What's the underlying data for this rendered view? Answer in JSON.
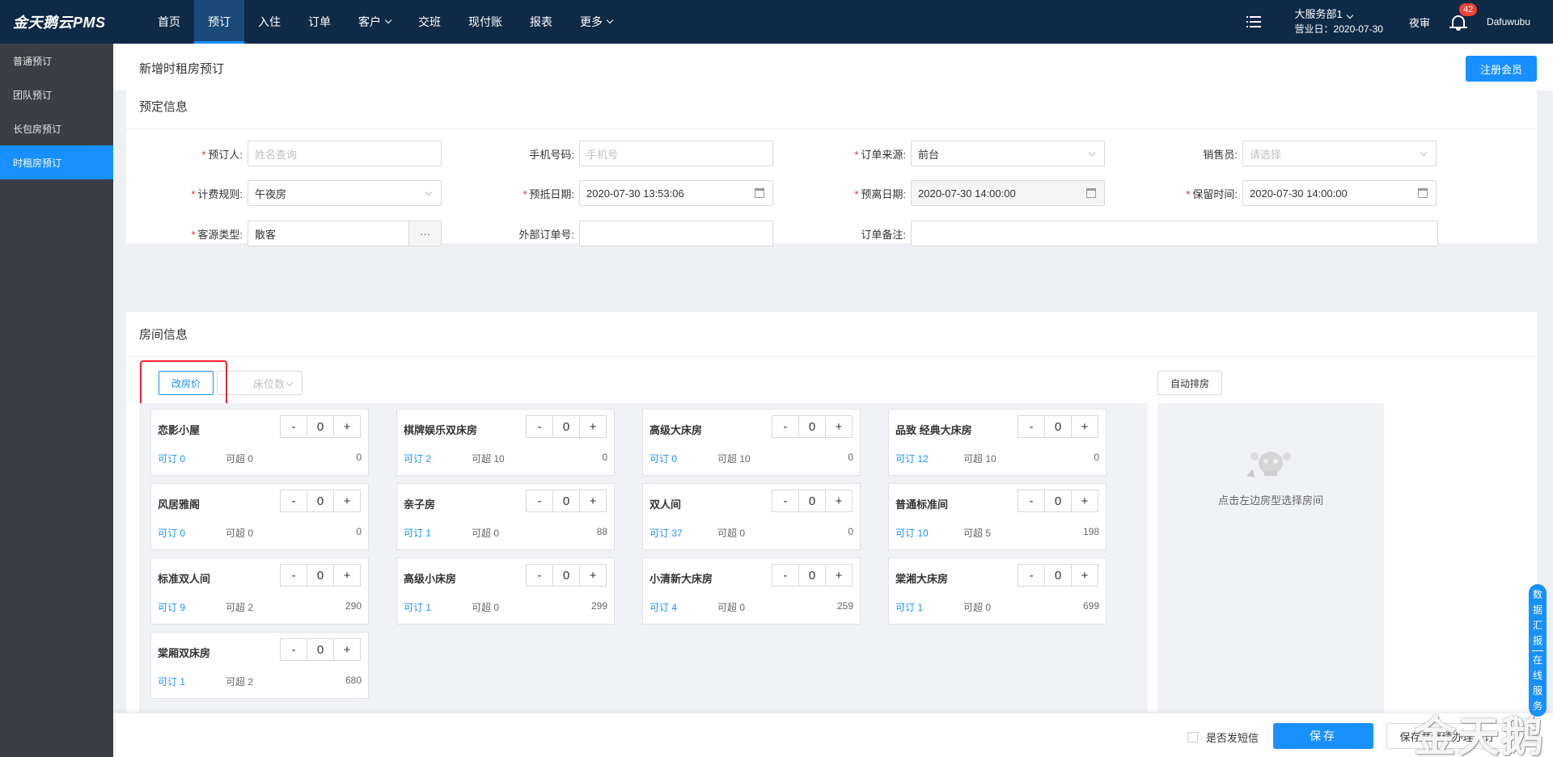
{
  "app": {
    "logo": "金天鹅云PMS"
  },
  "nav": [
    {
      "label": "首页",
      "active": false,
      "caret": false
    },
    {
      "label": "预订",
      "active": true,
      "caret": false
    },
    {
      "label": "入住",
      "active": false,
      "caret": false
    },
    {
      "label": "订单",
      "active": false,
      "caret": false
    },
    {
      "label": "客户",
      "active": false,
      "caret": true
    },
    {
      "label": "交班",
      "active": false,
      "caret": false
    },
    {
      "label": "现付账",
      "active": false,
      "caret": false
    },
    {
      "label": "报表",
      "active": false,
      "caret": false
    },
    {
      "label": "更多",
      "active": false,
      "caret": true
    }
  ],
  "header": {
    "dept": "大服务部1",
    "business_date": "营业日：2020-07-30",
    "night_audit": "夜审",
    "notif_count": "42",
    "username": "Dafuwubu"
  },
  "sidebar": [
    {
      "label": "普通预订",
      "active": false
    },
    {
      "label": "团队预订",
      "active": false
    },
    {
      "label": "长包房预订",
      "active": false
    },
    {
      "label": "时租房预订",
      "active": true
    }
  ],
  "page": {
    "title": "新增时租房预订",
    "register_btn": "注册会员"
  },
  "booking": {
    "title": "预定信息",
    "booker": {
      "label": "预订人:",
      "placeholder": "姓名查询"
    },
    "phone": {
      "label": "手机号码:",
      "placeholder": "手机号"
    },
    "source": {
      "label": "订单来源:",
      "value": "前台"
    },
    "sales": {
      "label": "销售员:",
      "placeholder": "请选择"
    },
    "rule": {
      "label": "计费规则:",
      "value": "午夜房"
    },
    "arrive": {
      "label": "预抵日期:",
      "value": "2020-07-30 13:53:06"
    },
    "depart": {
      "label": "预离日期:",
      "value": "2020-07-30 14:00:00"
    },
    "keep": {
      "label": "保留时间:",
      "value": "2020-07-30 14:00:00"
    },
    "guest_type": {
      "label": "客源类型:",
      "value": "散客",
      "more": "···"
    },
    "ext_order": {
      "label": "外部订单号:",
      "value": ""
    },
    "remark": {
      "label": "订单备注:",
      "value": ""
    }
  },
  "rooms": {
    "title": "房间信息",
    "change_price_btn": "改房价",
    "bed_placeholder": "床位数",
    "auto_btn": "自动排房",
    "empty_text": "点击左边房型选择房间",
    "items": [
      {
        "name": "恋影小屋",
        "qty": "0",
        "avail": "可订 0",
        "over": "可超 0",
        "price": "0"
      },
      {
        "name": "棋牌娱乐双床房",
        "qty": "0",
        "avail": "可订 2",
        "over": "可超 10",
        "price": "0"
      },
      {
        "name": "高级大床房",
        "qty": "0",
        "avail": "可订 0",
        "over": "可超 10",
        "price": "0"
      },
      {
        "name": "品致 经典大床房",
        "qty": "0",
        "avail": "可订 12",
        "over": "可超 10",
        "price": "0"
      },
      {
        "name": "风居雅阁",
        "qty": "0",
        "avail": "可订 0",
        "over": "可超 0",
        "price": "0"
      },
      {
        "name": "亲子房",
        "qty": "0",
        "avail": "可订 1",
        "over": "可超 0",
        "price": "88"
      },
      {
        "name": "双人间",
        "qty": "0",
        "avail": "可订 37",
        "over": "可超 0",
        "price": "0"
      },
      {
        "name": "普通标准间",
        "qty": "0",
        "avail": "可订 10",
        "over": "可超 5",
        "price": "198"
      },
      {
        "name": "标准双人间",
        "qty": "0",
        "avail": "可订 9",
        "over": "可超 2",
        "price": "290"
      },
      {
        "name": "高级小床房",
        "qty": "0",
        "avail": "可订 1",
        "over": "可超 0",
        "price": "299"
      },
      {
        "name": "小清新大床房",
        "qty": "0",
        "avail": "可订 4",
        "over": "可超 0",
        "price": "259"
      },
      {
        "name": "棠湘大床房",
        "qty": "0",
        "avail": "可订 1",
        "over": "可超 0",
        "price": "699"
      },
      {
        "name": "棠厢双床房",
        "qty": "0",
        "avail": "可订 1",
        "over": "可超 2",
        "price": "680"
      }
    ]
  },
  "footer": {
    "sms": "是否发短信",
    "save": "保存",
    "save_more": "保存并继续办理预订"
  },
  "side_tab": "数据汇报｜在线服务",
  "watermark": "金天鹅",
  "colors": {
    "primary": "#1890ff",
    "topbar": "#0f2a47",
    "sidebar": "#3b3f45",
    "required": "#f5222d"
  }
}
